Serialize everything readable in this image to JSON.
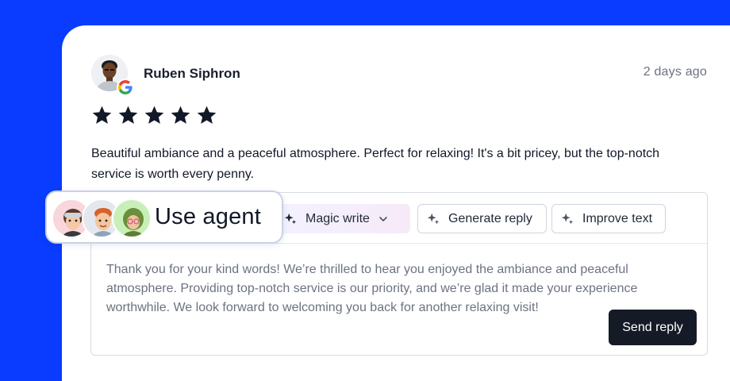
{
  "review": {
    "reviewer_name": "Ruben Siphron",
    "source_icon": "google-icon",
    "timestamp": "2 days ago",
    "rating": 5,
    "rating_max": 5,
    "text": "Beautiful ambiance and a peaceful atmosphere. Perfect for relaxing! It's a bit pricey, but the top-notch service is worth every penny."
  },
  "toolbar": {
    "magic_write_label": "Magic write",
    "generate_reply_label": "Generate reply",
    "improve_text_label": "Improve text"
  },
  "reply": {
    "text": "Thank you for your kind words! We’re thrilled to hear you enjoyed the ambiance and peaceful atmosphere. Providing top-notch service is our priority, and we’re glad it made your experience worthwhile. We look forward to welcoming you back for another relaxing visit!",
    "send_label": "Send reply"
  },
  "agent": {
    "label": "Use agent"
  },
  "colors": {
    "background": "#0a3cff",
    "card": "#ffffff",
    "send_button": "#151b26",
    "star": "#111827"
  }
}
